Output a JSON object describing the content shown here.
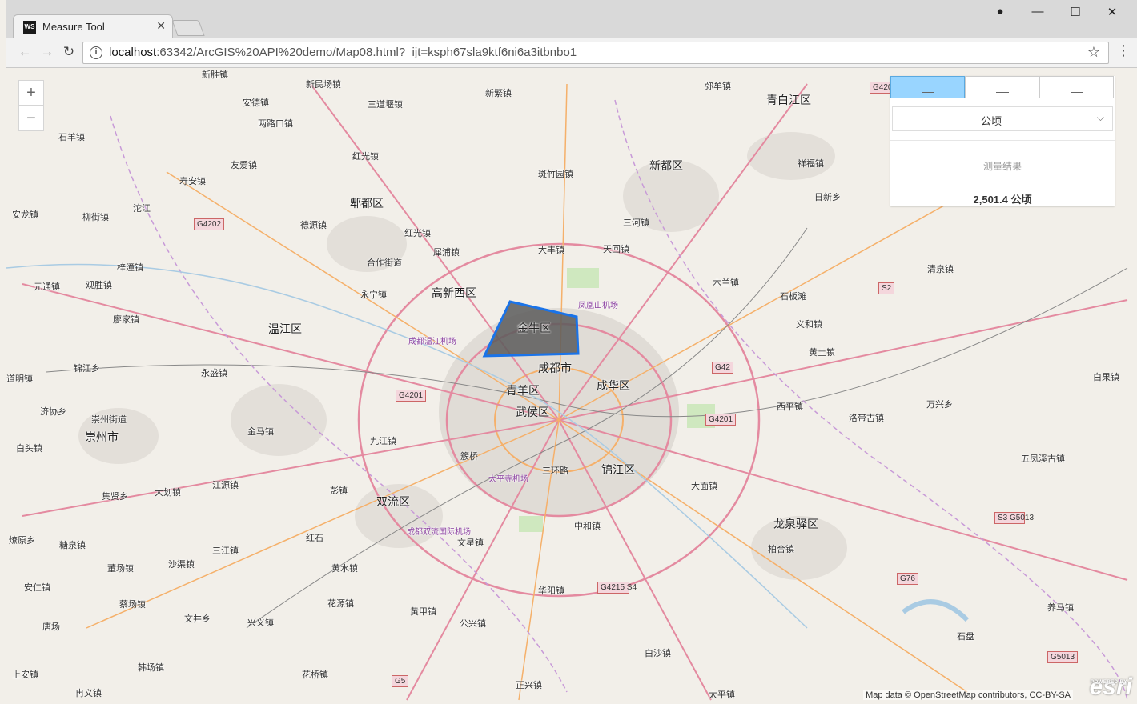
{
  "browser": {
    "tab_title": "Measure Tool",
    "tab_favicon": "WS",
    "url_host": "localhost",
    "url_rest": ":63342/ArcGIS%20API%20demo/Map08.html?_ijt=ksph67sla9ktf6ni6a3itbnbo1",
    "back_icon": "←",
    "forward_icon": "→",
    "reload_icon": "↻",
    "info_icon": "i",
    "star_icon": "☆",
    "menu_icon": "⋮",
    "tab_close_icon": "✕",
    "minimize_icon": "—",
    "maximize_icon": "☐",
    "close_icon": "✕",
    "account_icon": "●"
  },
  "map": {
    "zoom_in": "+",
    "zoom_out": "−",
    "attribution": "Map data © OpenStreetMap contributors, CC-BY-SA",
    "esri_logo": "esri",
    "esri_powered": "POWERED BY",
    "labels": {
      "l1": "新胜镇",
      "l2": "新民场镇",
      "l3": "安德镇",
      "l4": "三道堰镇",
      "l5": "新繁镇",
      "l6": "弥牟镇",
      "l7": "青白江区",
      "l8": "两路口镇",
      "l9": "石羊镇",
      "l10": "红光镇",
      "l11": "友爱镇",
      "l12": "斑竹园镇",
      "l13": "新都区",
      "l14": "祥福镇",
      "l15": "寿安镇",
      "l16": "郫都区",
      "l17": "日新乡",
      "l18": "安龙镇",
      "l19": "柳街镇",
      "l20": "沱江",
      "l21": "三河镇",
      "l22": "德源镇",
      "l23": "红光镇",
      "l24": "大丰镇",
      "l25": "天回镇",
      "l26": "梓潼镇",
      "l27": "合作街道",
      "l28": "犀浦镇",
      "l29": "清泉镇",
      "l30": "元通镇",
      "l31": "观胜镇",
      "l32": "永宁镇",
      "l33": "高新西区",
      "l34": "木兰镇",
      "l35": "石板滩",
      "l36": "廖家镇",
      "l37": "温江区",
      "l38": "金牛区",
      "l39": "义和镇",
      "l40": "成都温江机场",
      "l41": "凤凰山机场",
      "l42": "锦江乡",
      "l43": "永盛镇",
      "l44": "成都市",
      "l45": "黄土镇",
      "l46": "道明镇",
      "l47": "青羊区",
      "l48": "成华区",
      "l49": "济协乡",
      "l50": "崇州街道",
      "l51": "武侯区",
      "l52": "西平镇",
      "l53": "洛带古镇",
      "l54": "万兴乡",
      "l55": "白果镇",
      "l56": "崇州市",
      "l57": "金马镇",
      "l58": "白头镇",
      "l59": "九江镇",
      "l60": "簇桥",
      "l61": "三环路",
      "l62": "锦江区",
      "l63": "五凤溪古镇",
      "l64": "太平寺机场",
      "l65": "集贤乡",
      "l66": "大划镇",
      "l67": "江源镇",
      "l68": "彭镇",
      "l69": "双流区",
      "l70": "大面镇",
      "l71": "成都双流国际机场",
      "l72": "中和镇",
      "l73": "龙泉驿区",
      "l74": "燎原乡",
      "l75": "红石",
      "l76": "文星镇",
      "l77": "糖泉镇",
      "l78": "三江镇",
      "l79": "柏合镇",
      "l80": "董场镇",
      "l81": "沙渠镇",
      "l82": "黄水镇",
      "l83": "安仁镇",
      "l84": "华阳镇",
      "l85": "蔡场镇",
      "l86": "花源镇",
      "l87": "养马镇",
      "l88": "唐场",
      "l89": "文井乡",
      "l90": "兴义镇",
      "l91": "黄甲镇",
      "l92": "公兴镇",
      "l93": "石盘",
      "l94": "韩场镇",
      "l95": "白沙镇",
      "l96": "上安镇",
      "l97": "花桥镇",
      "l98": "冉义镇",
      "l99": "正兴镇",
      "l100": "太平镇"
    },
    "shields": {
      "s1": "G4202",
      "s2": "G4201",
      "s3": "G42",
      "s4": "G4201",
      "s5": "S2",
      "s6": "G4215 S4",
      "s7": "S3 G5013",
      "s8": "G76",
      "s9": "G5013",
      "s10": "G5",
      "s11": "G420"
    },
    "measured_polygon_color": "#5b5b5b",
    "outline_color": "#1a73e8"
  },
  "measure_widget": {
    "tabs": [
      "area-tool",
      "distance-tool",
      "location-tool"
    ],
    "active_tab": 0,
    "unit_selected": "公顷",
    "unit_chevron": "⌵",
    "result_label": "测量结果",
    "result_value": "2,501.4 公顷",
    "accent": "#99d5ff"
  }
}
